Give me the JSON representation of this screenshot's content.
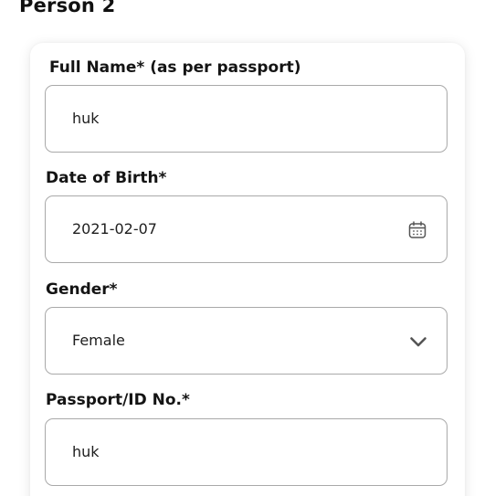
{
  "section": {
    "title": "Person 2"
  },
  "form": {
    "full_name": {
      "label": "Full Name* (as per passport)",
      "value": "huk"
    },
    "date_of_birth": {
      "label": "Date of Birth*",
      "value": "2021-02-07",
      "icon": "calendar-icon"
    },
    "gender": {
      "label": "Gender*",
      "value": "Female",
      "icon": "chevron-down-icon"
    },
    "passport": {
      "label": "Passport/ID No.*",
      "value": "huk"
    }
  },
  "colors": {
    "border": "#a9a9a9",
    "text": "#1a1a1a",
    "icon": "#555555"
  }
}
